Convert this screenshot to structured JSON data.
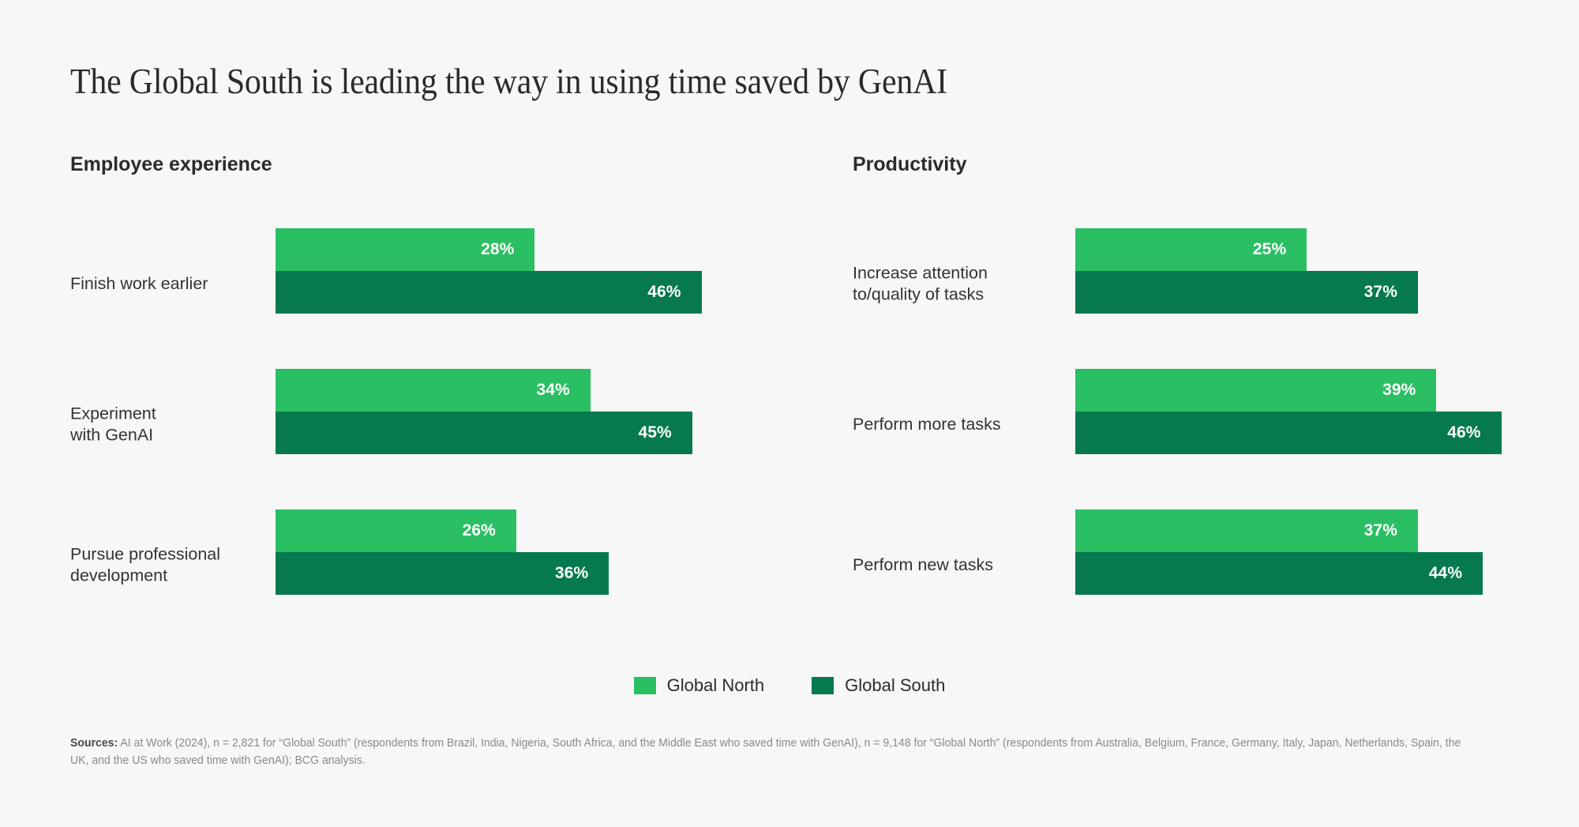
{
  "title": "The Global South is leading the way in using time saved by GenAI",
  "legend": {
    "north_label": "Global North",
    "south_label": "Global South",
    "north_color": "#2bbf63",
    "south_color": "#067a4e"
  },
  "sources": {
    "label": "Sources:",
    "text": " AI at Work (2024), n = 2,821 for “Global South” (respondents from Brazil, India, Nigeria, South Africa, and the Middle East who saved time with GenAI), n = 9,148 for “Global North” (respondents from Australia, Belgium, France, Germany, Italy, Japan, Netherlands, Spain, the UK, and the US who saved time with GenAI); BCG analysis."
  },
  "panels": [
    {
      "heading": "Employee experience",
      "rows": [
        {
          "label": "Finish work earlier",
          "north": "28%",
          "south": "46%",
          "north_value": 28,
          "south_value": 46
        },
        {
          "label": "Experiment\nwith GenAI",
          "north": "34%",
          "south": "45%",
          "north_value": 34,
          "south_value": 45
        },
        {
          "label": "Pursue professional\ndevelopment",
          "north": "26%",
          "south": "36%",
          "north_value": 26,
          "south_value": 36
        }
      ]
    },
    {
      "heading": "Productivity",
      "rows": [
        {
          "label": "Increase attention\nto/quality of tasks",
          "north": "25%",
          "south": "37%",
          "north_value": 25,
          "south_value": 37
        },
        {
          "label": "Perform more tasks",
          "north": "39%",
          "south": "46%",
          "north_value": 39,
          "south_value": 46
        },
        {
          "label": "Perform new tasks",
          "north": "37%",
          "south": "44%",
          "north_value": 37,
          "south_value": 44
        }
      ]
    }
  ],
  "chart_data": {
    "type": "bar",
    "orientation": "horizontal",
    "title": "The Global South is leading the way in using time saved by GenAI",
    "xlabel": "",
    "ylabel": "",
    "xlim": [
      0,
      46
    ],
    "grid": false,
    "legend_position": "bottom-center",
    "value_unit": "percent",
    "panels": [
      {
        "name": "Employee experience",
        "categories": [
          "Finish work earlier",
          "Experiment with GenAI",
          "Pursue professional development"
        ],
        "series": [
          {
            "name": "Global North",
            "color": "#2bbf63",
            "values": [
              28,
              34,
              26
            ]
          },
          {
            "name": "Global South",
            "color": "#067a4e",
            "values": [
              46,
              45,
              36
            ]
          }
        ]
      },
      {
        "name": "Productivity",
        "categories": [
          "Increase attention to/quality of tasks",
          "Perform more tasks",
          "Perform new tasks"
        ],
        "series": [
          {
            "name": "Global North",
            "color": "#2bbf63",
            "values": [
              25,
              39,
              37
            ]
          },
          {
            "name": "Global South",
            "color": "#067a4e",
            "values": [
              46,
              46,
              44
            ]
          }
        ]
      }
    ]
  }
}
